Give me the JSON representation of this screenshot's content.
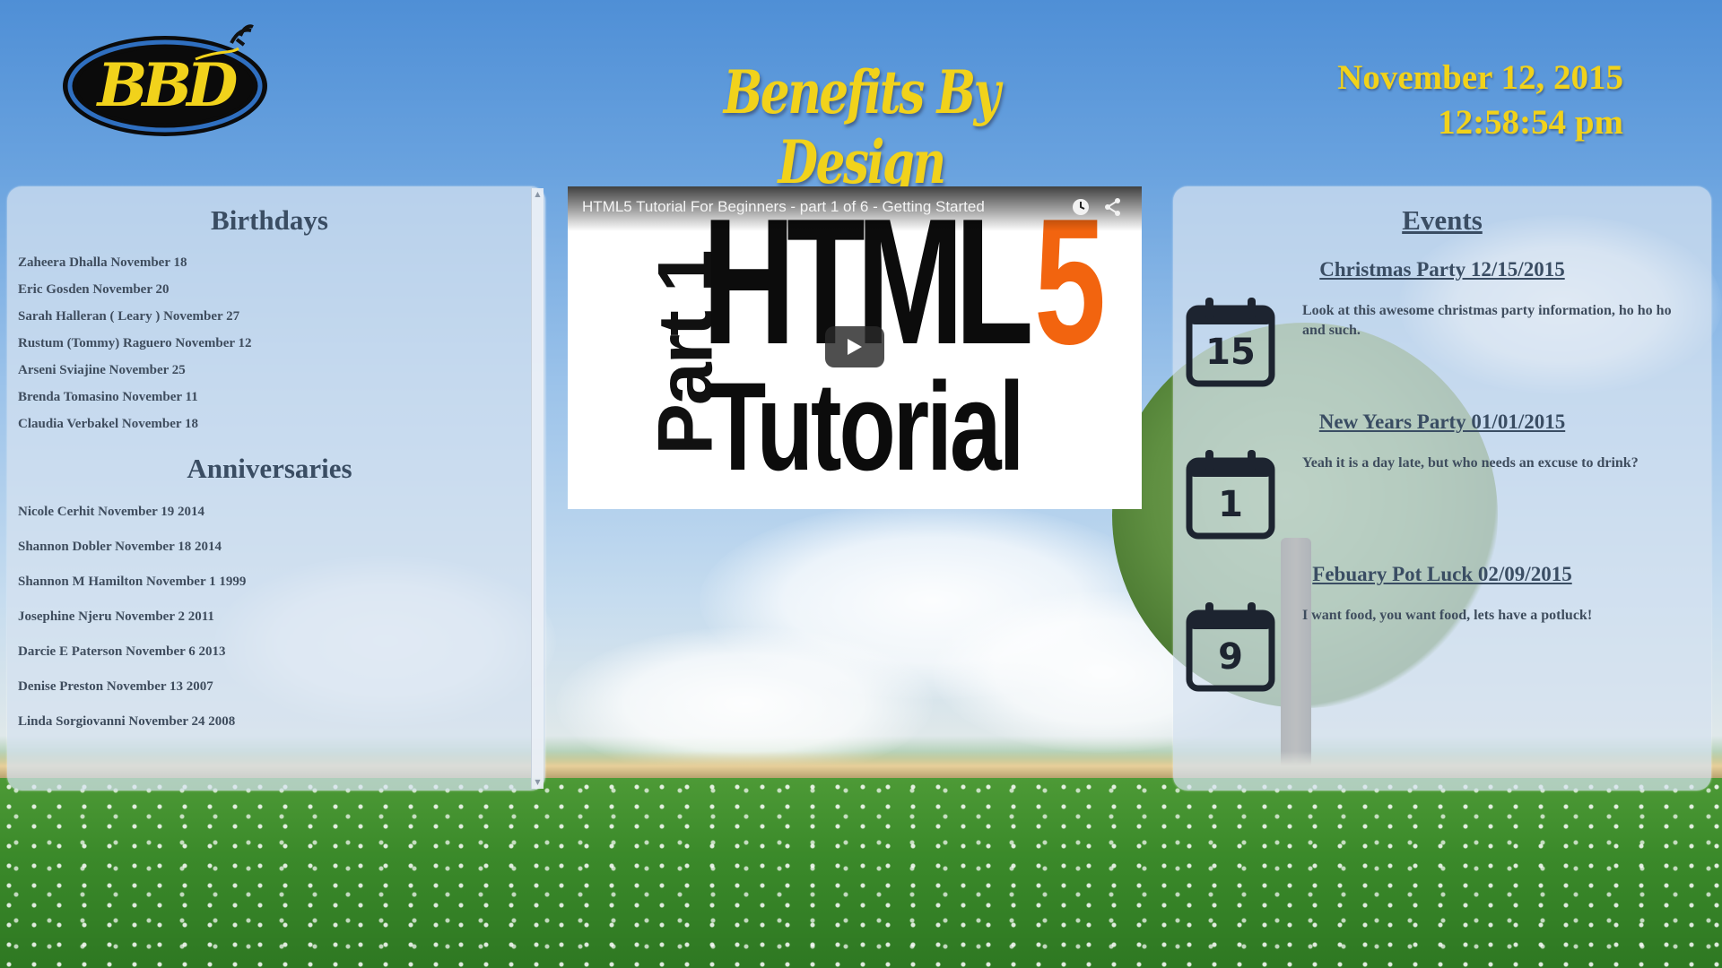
{
  "header": {
    "logo_text": "BBD",
    "site_title": "Benefits By Design",
    "date": "November 12, 2015",
    "time": "12:58:54 pm"
  },
  "birthdays": {
    "title": "Birthdays",
    "items": [
      "Zaheera Dhalla November 18",
      "Eric Gosden November 20",
      "Sarah Halleran ( Leary ) November 27",
      "Rustum (Tommy) Raguero November 12",
      "Arseni Sviajine November 25",
      "Brenda Tomasino November 11",
      "Claudia Verbakel November 18"
    ]
  },
  "anniversaries": {
    "title": "Anniversaries",
    "items": [
      "Nicole Cerhit November 19 2014",
      "Shannon Dobler November 18 2014",
      "Shannon M Hamilton November 1 1999",
      "Josephine Njeru November 2 2011",
      "Darcie E Paterson November 6 2013",
      "Denise Preston November 13 2007",
      "Linda Sorgiovanni November 24 2008"
    ]
  },
  "video": {
    "title": "HTML5 Tutorial For Beginners - part 1 of 6 - Getting Started",
    "thumb_part": "Part 1",
    "thumb_html": "HTML",
    "thumb_five": "5",
    "thumb_tutorial": "Tutorial",
    "icons": [
      "watch-later-icon",
      "share-icon",
      "play-icon"
    ]
  },
  "events": {
    "title": "Events",
    "items": [
      {
        "title": "Christmas Party 12/15/2015",
        "day": "15",
        "description": "Look at this awesome christmas party information, ho ho ho and such."
      },
      {
        "title": "New Years Party 01/01/2015",
        "day": "1",
        "description": "Yeah it is a day late, but who needs an excuse to drink?"
      },
      {
        "title": "Febuary Pot Luck 02/09/2015",
        "day": "9",
        "description": "I want food, you want food, lets have a potluck!"
      }
    ]
  },
  "colors": {
    "accent_yellow": "#f1d21b",
    "heading_blue": "#3a4d63",
    "thumb_orange": "#f2640f"
  }
}
